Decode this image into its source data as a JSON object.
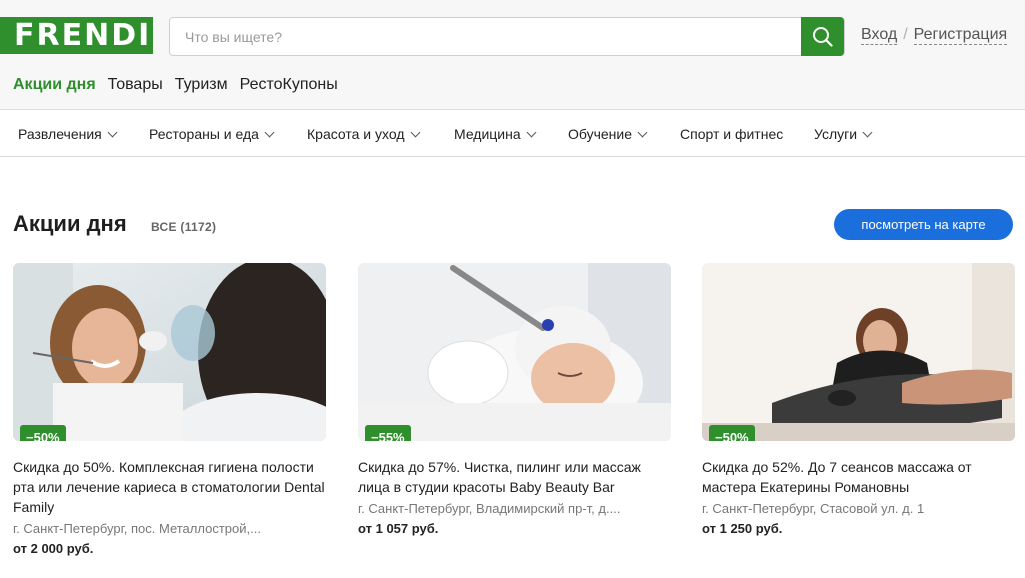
{
  "logo": "FRENDI",
  "search": {
    "placeholder": "Что вы ищете?"
  },
  "auth": {
    "login": "Вход",
    "separator": "/",
    "register": "Регистрация"
  },
  "tabs": [
    "Акции дня",
    "Товары",
    "Туризм",
    "РестоКупоны"
  ],
  "categories": [
    "Развлечения",
    "Рестораны и еда",
    "Красота и уход",
    "Медицина",
    "Обучение",
    "Спорт и фитнес",
    "Услуги"
  ],
  "section": {
    "title": "Акции дня",
    "all_label": "ВСЕ (1172)",
    "map_button": "посмотреть на карте"
  },
  "cards": [
    {
      "discount": "−50%",
      "title": "Скидка до 50%. Комплексная гигиена полости рта или лечение кариеса в стоматологии Dental Family",
      "address": "г. Санкт-Петербург, пос. Металлострой,...",
      "price": "от 2 000 руб."
    },
    {
      "discount": "−55%",
      "title": "Скидка до 57%. Чистка, пилинг или массаж лица в студии красоты Baby Beauty Bar",
      "address": "г. Санкт-Петербург, Владимирский пр-т, д....",
      "price": "от 1 057 руб."
    },
    {
      "discount": "−50%",
      "title": "Скидка до 52%. До 7 сеансов массажа от мастера Екатерины Романовны",
      "address": "г. Санкт-Петербург, Стасовой ул. д. 1",
      "price": "от 1 250 руб."
    }
  ],
  "colors": {
    "brand_green": "#2e8f2c",
    "map_button_blue": "#1a6fdc"
  }
}
